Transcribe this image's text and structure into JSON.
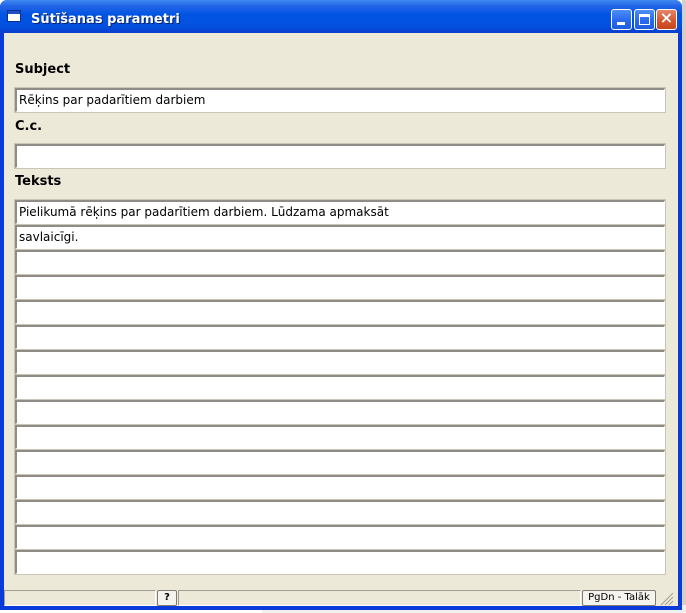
{
  "window": {
    "title": "Sūtīšanas parametri"
  },
  "form": {
    "subject_label": "Subject",
    "subject_value": "Rēķins par padarītiem darbiem",
    "cc_label": "C.c.",
    "cc_value": "",
    "text_label": "Teksts",
    "text_lines": [
      "Pielikumā rēķins par padarītiem darbiem. Lūdzama apmaksāt",
      "savlaicīgi.",
      "",
      "",
      "",
      "",
      "",
      "",
      "",
      "",
      "",
      "",
      "",
      "",
      ""
    ]
  },
  "statusbar": {
    "help_label": "?",
    "next_label": "PgDn - Talāk"
  },
  "icons": {
    "app": "window-app-icon",
    "minimize": "minimize-icon",
    "maximize": "maximize-icon",
    "close": "close-icon",
    "grip": "resize-grip-icon"
  },
  "colors": {
    "titlebar": "#0054e3",
    "client_bg": "#ece9d8",
    "close_button": "#d4582f"
  }
}
